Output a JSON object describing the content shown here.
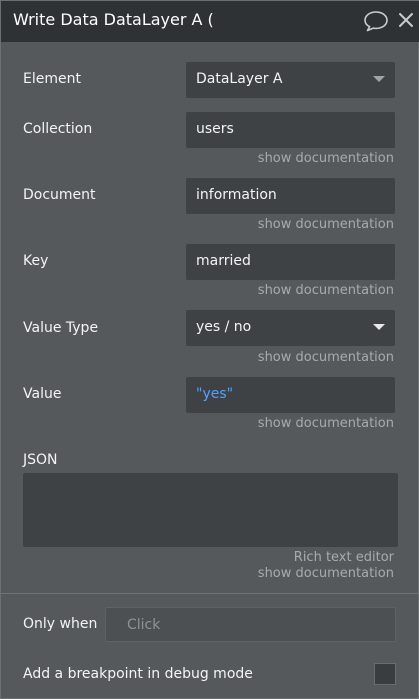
{
  "header": {
    "title": "Write Data DataLayer A (",
    "comment_icon": "speech-bubble-icon",
    "close_icon": "close-icon"
  },
  "fields": {
    "element": {
      "label": "Element",
      "value": "DataLayer A"
    },
    "collection": {
      "label": "Collection",
      "value": "users",
      "doc": "show documentation"
    },
    "document": {
      "label": "Document",
      "value": "information",
      "doc": "show documentation"
    },
    "key": {
      "label": "Key",
      "value": "married",
      "doc": "show documentation"
    },
    "value_type": {
      "label": "Value Type",
      "value": "yes / no",
      "doc": "show documentation"
    },
    "value": {
      "label": "Value",
      "value": "\"yes\"",
      "doc": "show documentation"
    },
    "json": {
      "label": "JSON",
      "rich_text": "Rich text editor",
      "doc": "show documentation"
    }
  },
  "only_when": {
    "label": "Only when",
    "button": "Click"
  },
  "breakpoint": {
    "label": "Add a breakpoint in debug mode",
    "checked": false
  },
  "colors": {
    "header_bg": "#2f3234",
    "panel_bg": "#55595b",
    "field_bg": "#3e4244",
    "dynamic_value": "#4fa3ff"
  }
}
